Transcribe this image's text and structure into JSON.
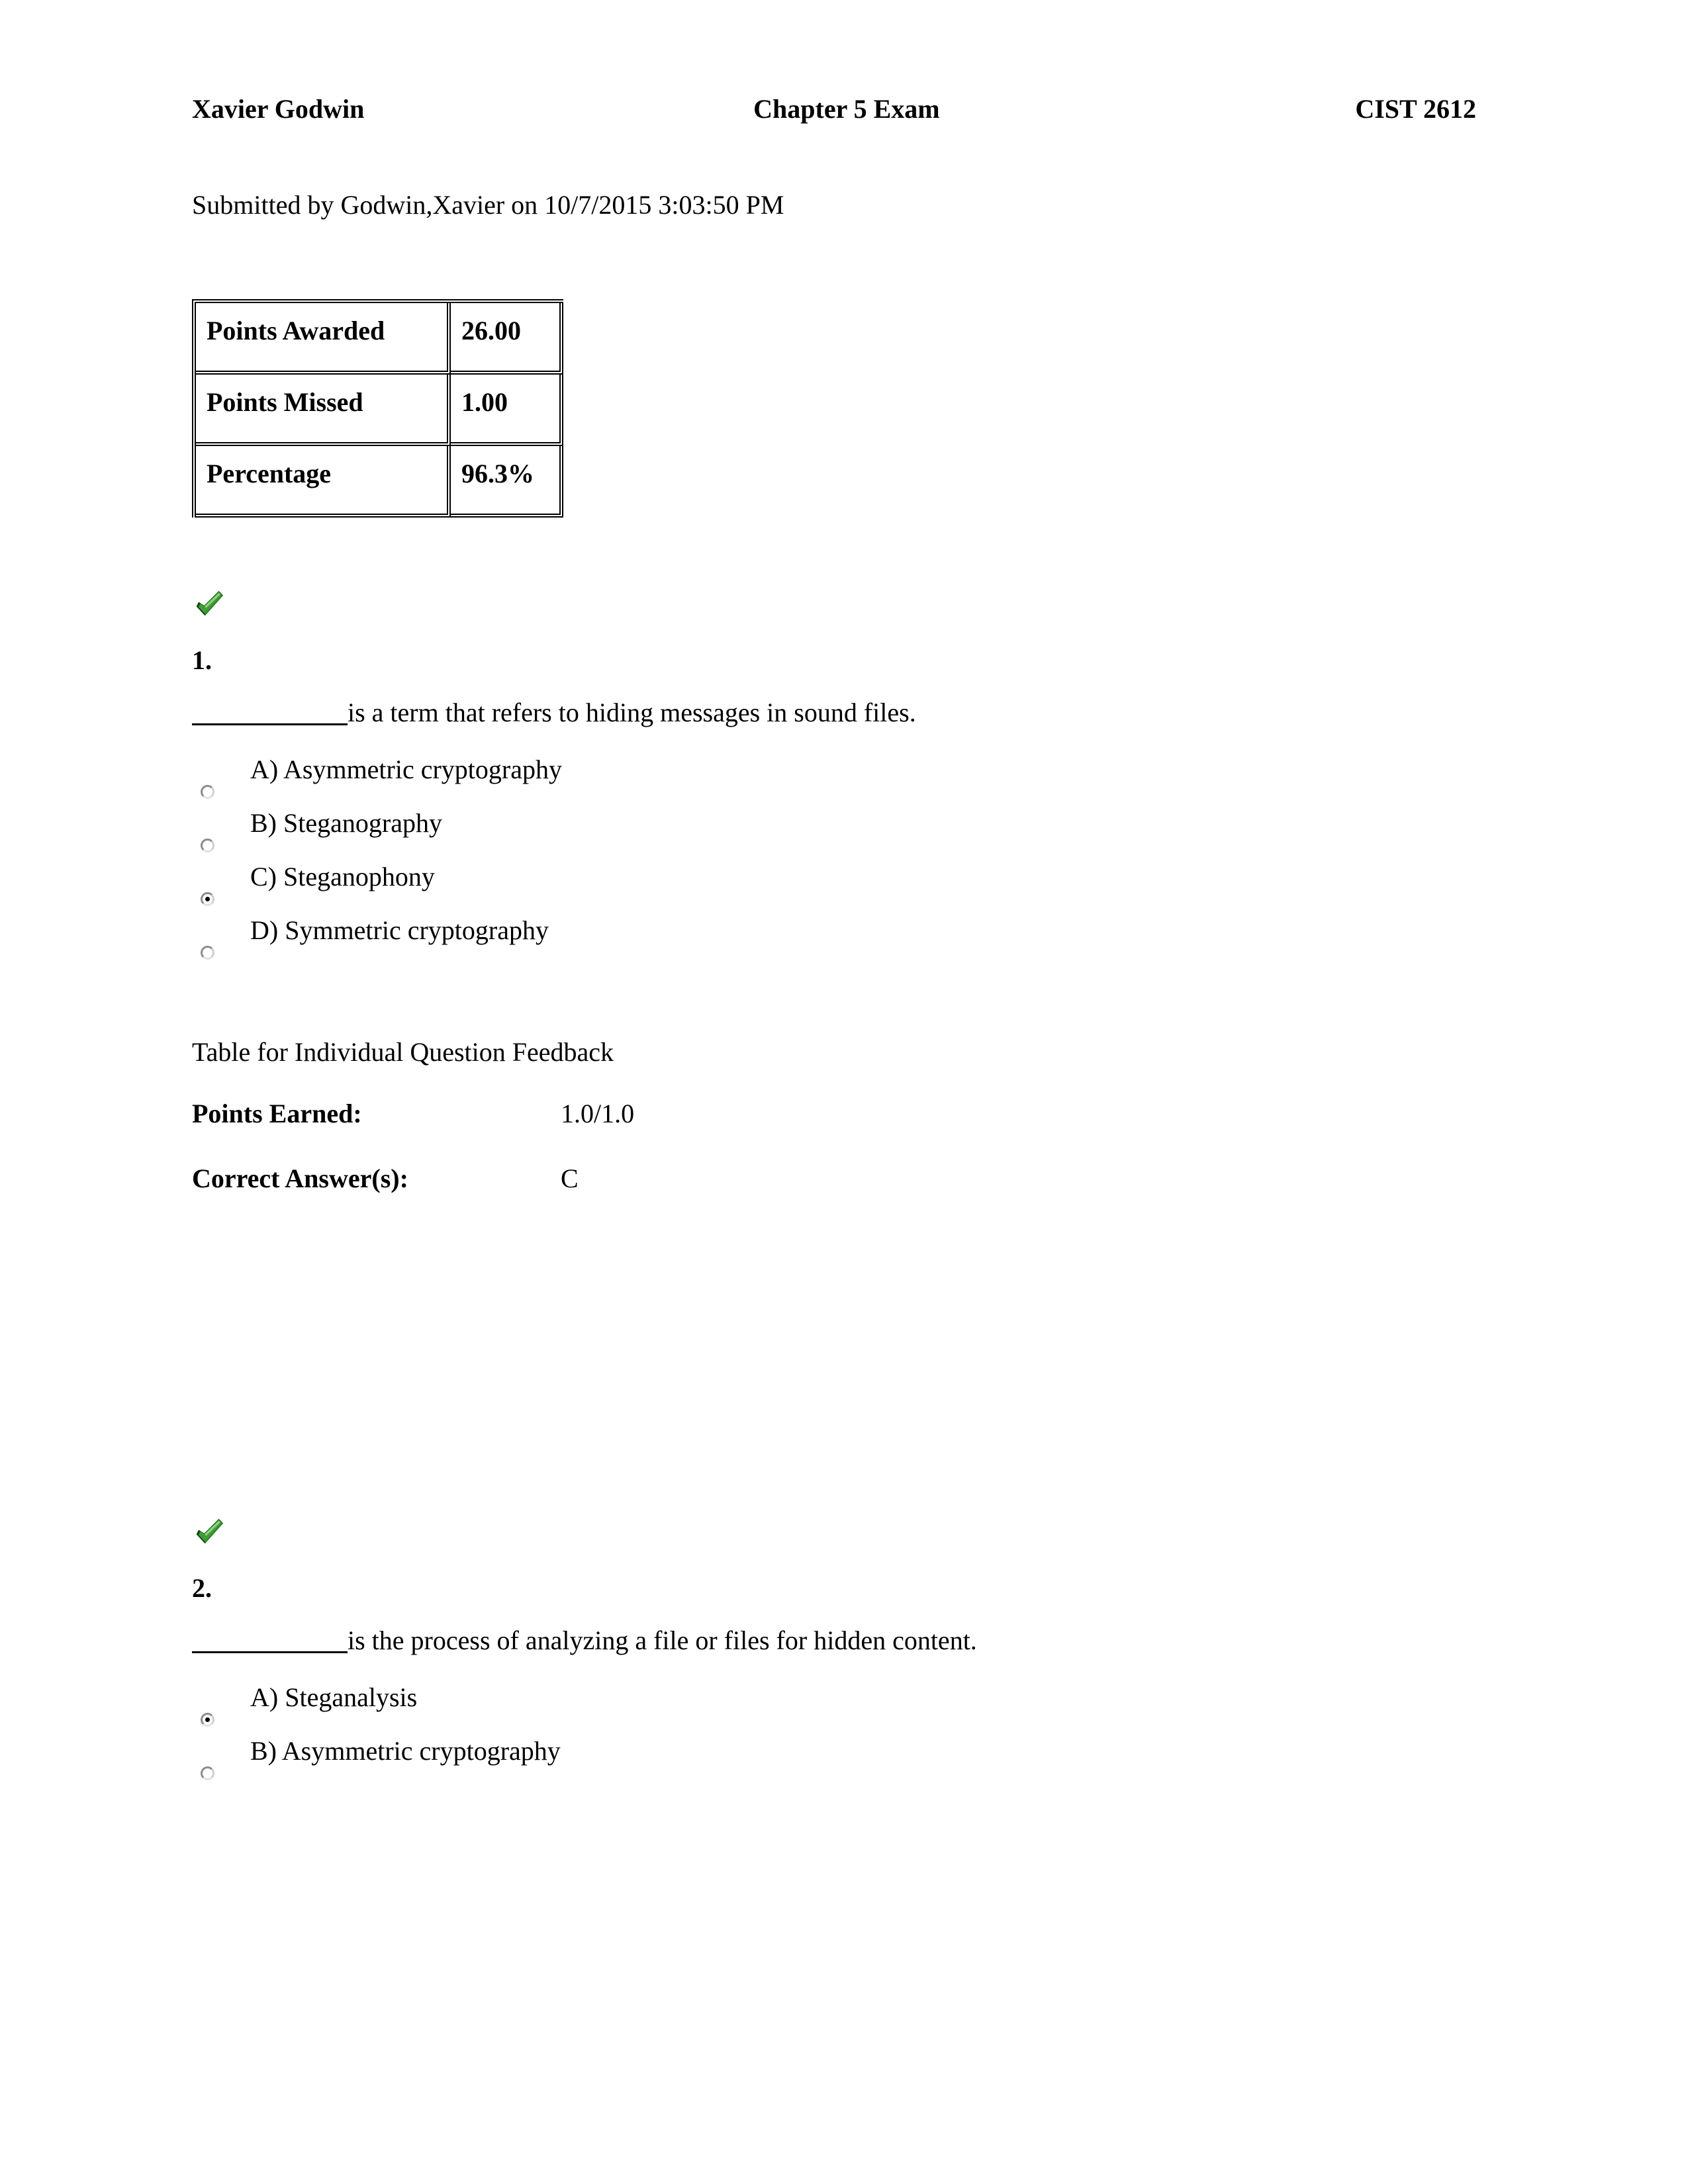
{
  "header": {
    "student_name": "Xavier Godwin",
    "exam_title": "Chapter 5 Exam",
    "course_code": "CIST 2612"
  },
  "submission": {
    "line": "Submitted by Godwin,Xavier on 10/7/2015 3:03:50 PM"
  },
  "score_table": {
    "rows": [
      {
        "label": "Points Awarded",
        "value": "26.00"
      },
      {
        "label": "Points Missed",
        "value": "1.00"
      },
      {
        "label": "Percentage",
        "value": "96.3%"
      }
    ]
  },
  "feedback_labels": {
    "table_caption": "Table for Individual Question Feedback",
    "points_earned_label": "Points Earned:",
    "correct_answer_label": "Correct Answer(s):"
  },
  "icons": {
    "correct_mark": "green-check-icon",
    "radio_unselected": "radio-unselected-icon",
    "radio_selected": "radio-selected-icon"
  },
  "colors": {
    "check_green_light": "#4aa33f",
    "check_green_mid": "#2c7a26",
    "check_green_dark": "#145210",
    "text": "#000000",
    "page_background": "#ffffff",
    "radio_border": "#8c8c8c"
  },
  "questions": [
    {
      "number": "1.",
      "status": "correct",
      "blank": "__________",
      "prompt": "is a term that refers to hiding messages in sound files.",
      "options": [
        {
          "label": "A) Asymmetric cryptography",
          "selected": false
        },
        {
          "label": "B) Steganography",
          "selected": false
        },
        {
          "label": "C) Steganophony",
          "selected": true
        },
        {
          "label": "D) Symmetric cryptography",
          "selected": false
        }
      ],
      "feedback": {
        "points_earned": "1.0/1.0",
        "correct_answer": "C"
      }
    },
    {
      "number": "2.",
      "status": "correct",
      "blank": "__________",
      "prompt": "is the process of analyzing a file or files for hidden content.",
      "options": [
        {
          "label": "A) Steganalysis",
          "selected": true
        },
        {
          "label": "B) Asymmetric cryptography",
          "selected": false
        }
      ]
    }
  ]
}
